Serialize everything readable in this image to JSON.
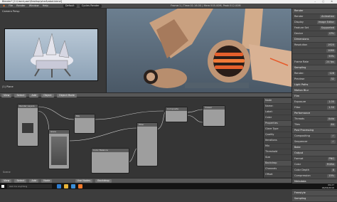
{
  "titlebar": {
    "title": "Blender* [C:\\Users\\user\\Desktop\\shed\\robot.blend]",
    "controls": "– ▢ ✕"
  },
  "menubar": {
    "items": [
      "File",
      "Render",
      "Window",
      "Help"
    ],
    "layout": "Default",
    "engine": "Cycles Render",
    "stats": "Frame:1 | Time:01:16.00 | Mem:505.00M, Peak:512.00M"
  },
  "camera_view": {
    "label": "Camera Persp",
    "object": "(1) Plane"
  },
  "view3d_header": {
    "buttons": [
      "View",
      "Select",
      "Add",
      "Object",
      "Object Mode"
    ]
  },
  "node_header": {
    "buttons": [
      "View",
      "Select",
      "Add",
      "Node"
    ],
    "toggles": [
      "Use Nodes",
      "Backdrop"
    ]
  },
  "node_editor": {
    "label": "Scene",
    "nodes": [
      "Render Layers",
      "Mix",
      "Glare",
      "Color Balance",
      "Filter",
      "Composite",
      "Viewer"
    ]
  },
  "node_props": {
    "rows": [
      "Node",
      "Name:",
      "Label:",
      "Color",
      "Properties",
      "Glare Type",
      "Quality",
      "Iterations",
      "Mix",
      "Threshold",
      "Size",
      "Backdrop",
      "Channels",
      "Offset"
    ]
  },
  "properties": {
    "rows": [
      {
        "label": "Render",
        "section": true
      },
      {
        "label": "Render",
        "value": "Animation"
      },
      {
        "label": "Display",
        "value": "Image Editor"
      },
      {
        "label": "Feature Set",
        "value": "Supported"
      },
      {
        "label": "Device",
        "value": "CPU"
      },
      {
        "label": "Dimensions",
        "section": true
      },
      {
        "label": "Resolution",
        "value": "1920"
      },
      {
        "label": "",
        "value": "1080"
      },
      {
        "label": "",
        "value": "50%"
      },
      {
        "label": "Frame Rate",
        "value": "24 fps"
      },
      {
        "label": "Sampling",
        "section": true
      },
      {
        "label": "Render:",
        "value": "128"
      },
      {
        "label": "Preview:",
        "value": "32"
      },
      {
        "label": "Light Paths",
        "section": true
      },
      {
        "label": "Motion Blur",
        "section": true
      },
      {
        "label": "Film",
        "section": true
      },
      {
        "label": "Exposure",
        "value": "1.00"
      },
      {
        "label": "Filter",
        "value": "1.50"
      },
      {
        "label": "Performance",
        "section": true
      },
      {
        "label": "Threads",
        "value": "Auto"
      },
      {
        "label": "Tiles",
        "value": "64"
      },
      {
        "label": "Post Processing",
        "section": true
      },
      {
        "label": "Compositing",
        "value": "✓"
      },
      {
        "label": "Sequencer",
        "value": "✓"
      },
      {
        "label": "Bake",
        "section": true
      },
      {
        "label": "Output",
        "section": true
      },
      {
        "label": "Format",
        "value": "PNG"
      },
      {
        "label": "Color",
        "value": "RGBA"
      },
      {
        "label": "Color Depth",
        "value": "8"
      },
      {
        "label": "Compression",
        "value": "15%"
      },
      {
        "label": "Metadata",
        "section": true
      },
      {
        "label": "Stereoscopy",
        "section": true
      },
      {
        "label": "Freestyle",
        "section": true
      },
      {
        "label": "Sampling",
        "section": true
      }
    ]
  },
  "taskbar": {
    "search": "Ask me anything",
    "time": "09:27",
    "date": "04/06/2016"
  }
}
